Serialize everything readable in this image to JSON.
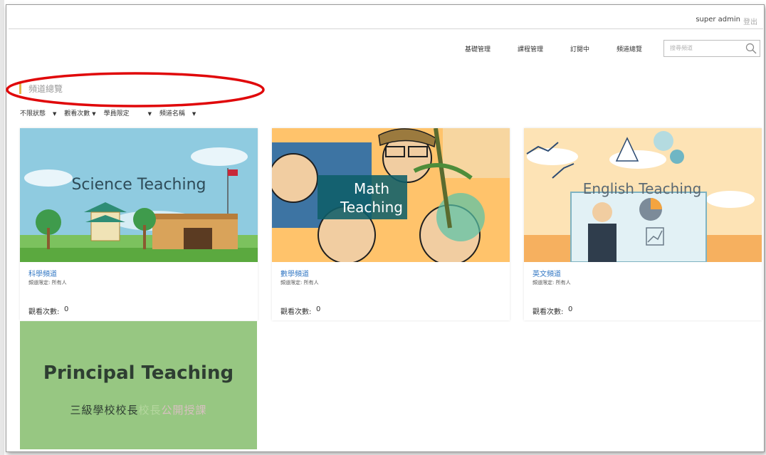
{
  "header": {
    "user": "super admin",
    "logout": "登出"
  },
  "nav": {
    "items": [
      "基礎管理",
      "課程管理",
      "訂閱中",
      "頻道總覽"
    ]
  },
  "search": {
    "placeholder": "搜尋頻道"
  },
  "section": {
    "title": "頻道總覽"
  },
  "filters": [
    "不限狀態",
    "觀看次數",
    "學員限定",
    "頻道名稱"
  ],
  "cards": [
    {
      "banner": "Science Teaching",
      "name": "科學頻道",
      "permission": "頻道限定: 所有人",
      "views_label": "觀看次數:",
      "views": "0"
    },
    {
      "banner_line1": "Math",
      "banner_line2": "Teaching",
      "name": "數學頻道",
      "permission": "頻道限定: 所有人",
      "views_label": "觀看次數:",
      "views": "0"
    },
    {
      "banner": "English Teaching",
      "name": "英文頻道",
      "permission": "頻道限定: 所有人",
      "views_label": "觀看次數:",
      "views": "0"
    }
  ],
  "principal": {
    "title": "Principal Teaching",
    "subtitle_main": "三級學校校長",
    "subtitle_faint": "校長",
    "subtitle_faint2": "公開授課"
  },
  "colors": {
    "accent": "#e5b84b",
    "link": "#3579c4",
    "annotation": "#e0080a"
  }
}
